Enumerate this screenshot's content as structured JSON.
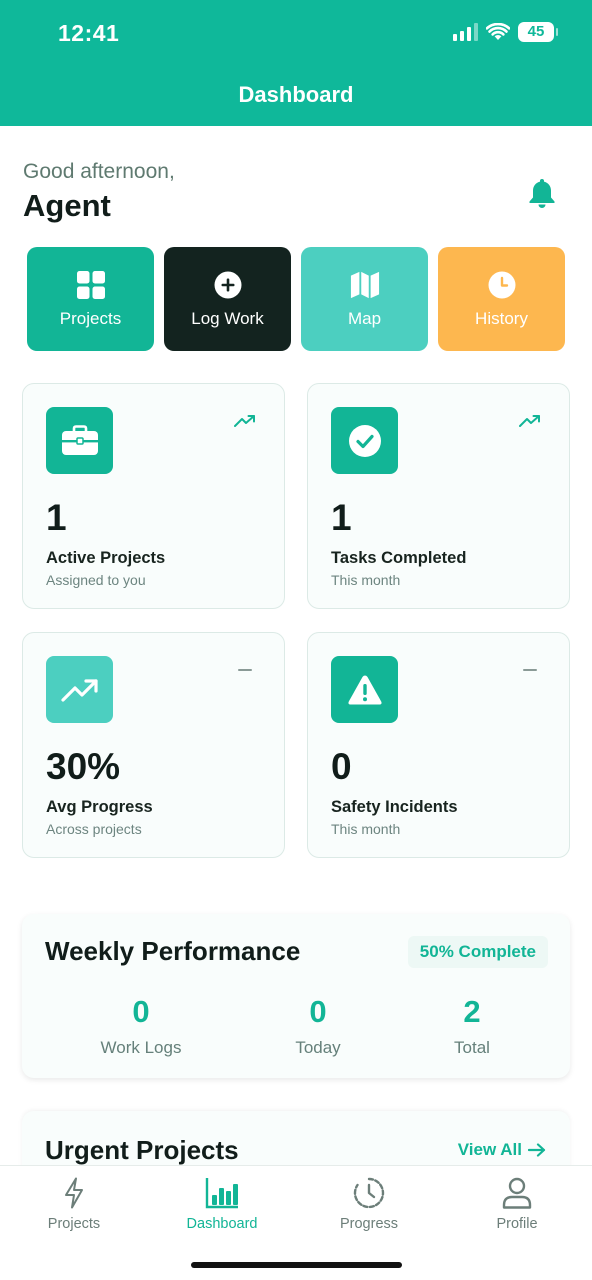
{
  "status": {
    "time": "12:41",
    "battery": "45"
  },
  "header": {
    "title": "Dashboard"
  },
  "greeting": {
    "line": "Good afternoon,",
    "name": "Agent"
  },
  "quick_actions": [
    {
      "label": "Projects",
      "icon": "grid-icon",
      "color": "#12b596"
    },
    {
      "label": "Log Work",
      "icon": "plus-circle-icon",
      "color": "#13231f"
    },
    {
      "label": "Map",
      "icon": "map-icon",
      "color": "#4ccfc0"
    },
    {
      "label": "History",
      "icon": "clock-icon",
      "color": "#fdb74f"
    }
  ],
  "stats": [
    {
      "value": "1",
      "title": "Active Projects",
      "subtitle": "Assigned to you",
      "icon": "briefcase-icon",
      "trend": "trend-up-icon"
    },
    {
      "value": "1",
      "title": "Tasks Completed",
      "subtitle": "This month",
      "icon": "check-circle-icon",
      "trend": "trend-up-icon"
    },
    {
      "value": "30%",
      "title": "Avg Progress",
      "subtitle": "Across projects",
      "icon": "trending-up-icon",
      "trend": "minus-icon"
    },
    {
      "value": "0",
      "title": "Safety Incidents",
      "subtitle": "This month",
      "icon": "warning-icon",
      "trend": "minus-icon"
    }
  ],
  "weekly": {
    "title": "Weekly Performance",
    "badge": "50% Complete",
    "items": [
      {
        "value": "0",
        "label": "Work Logs"
      },
      {
        "value": "0",
        "label": "Today"
      },
      {
        "value": "2",
        "label": "Total"
      }
    ]
  },
  "urgent": {
    "title": "Urgent Projects",
    "view_all": "View All"
  },
  "tabs": [
    {
      "label": "Projects",
      "icon": "bolt-icon",
      "active": false
    },
    {
      "label": "Dashboard",
      "icon": "bar-chart-icon",
      "active": true
    },
    {
      "label": "Progress",
      "icon": "history-icon",
      "active": false
    },
    {
      "label": "Profile",
      "icon": "person-icon",
      "active": false
    }
  ],
  "colors": {
    "primary": "#0fb89a",
    "accent": "#12b596",
    "dark": "#13231f",
    "teal_light": "#4ccfc0",
    "orange": "#fdb74f"
  }
}
